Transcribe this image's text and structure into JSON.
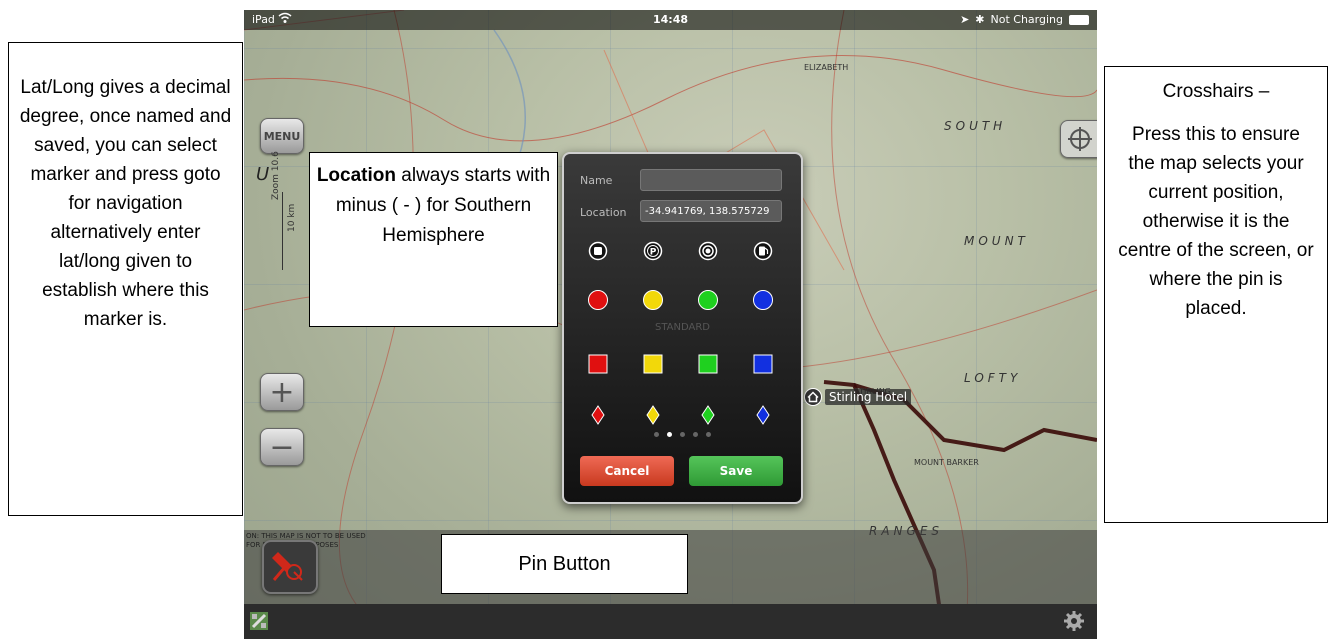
{
  "status_bar": {
    "device": "iPad",
    "time": "14:48",
    "charging": "Not Charging"
  },
  "map": {
    "menu_label": "MENU",
    "zoom_in_label": "+",
    "zoom_out_label": "−",
    "scale_zoom": "Zoom 10.6",
    "scale_distance": "10 km",
    "stirling_label": "Stirling Hotel",
    "warning_text_line1": "ON: THIS MAP IS NOT TO BE USED",
    "warning_text_line2": "FOR M... ATION PURPOSES"
  },
  "dialog": {
    "name_label": "Name",
    "name_value": "",
    "location_label": "Location",
    "location_value": "-34.941769, 138.575729",
    "standard_label": "STANDARD",
    "icon_rows": [
      [
        "stop-icon",
        "parking-icon",
        "target-icon",
        "fuel-icon"
      ],
      [
        "red-circle",
        "yellow-circle",
        "green-circle",
        "blue-circle"
      ],
      [
        "red-square",
        "yellow-square",
        "green-square",
        "blue-square"
      ],
      [
        "red-diamond",
        "yellow-diamond",
        "green-diamond",
        "blue-diamond"
      ]
    ],
    "colors": {
      "red": "#e01010",
      "yellow": "#f2d80a",
      "green": "#1fd01f",
      "blue": "#1230e0"
    },
    "page_count": 5,
    "active_page": 2,
    "cancel_label": "Cancel",
    "save_label": "Save"
  },
  "callouts": {
    "latlong": "Lat/Long gives a decimal degree, once named and saved, you can select marker and press goto for navigation alternatively enter lat/long given to establish where this marker is.",
    "location_bold": "Location",
    "location_rest": " always starts with minus ( - ) for Southern Hemisphere",
    "crosshairs_title": "Crosshairs –",
    "crosshairs_body": "Press this to ensure the map selects your current position, otherwise it is the centre of the screen, or where the pin is placed.",
    "pin": "Pin Button"
  }
}
